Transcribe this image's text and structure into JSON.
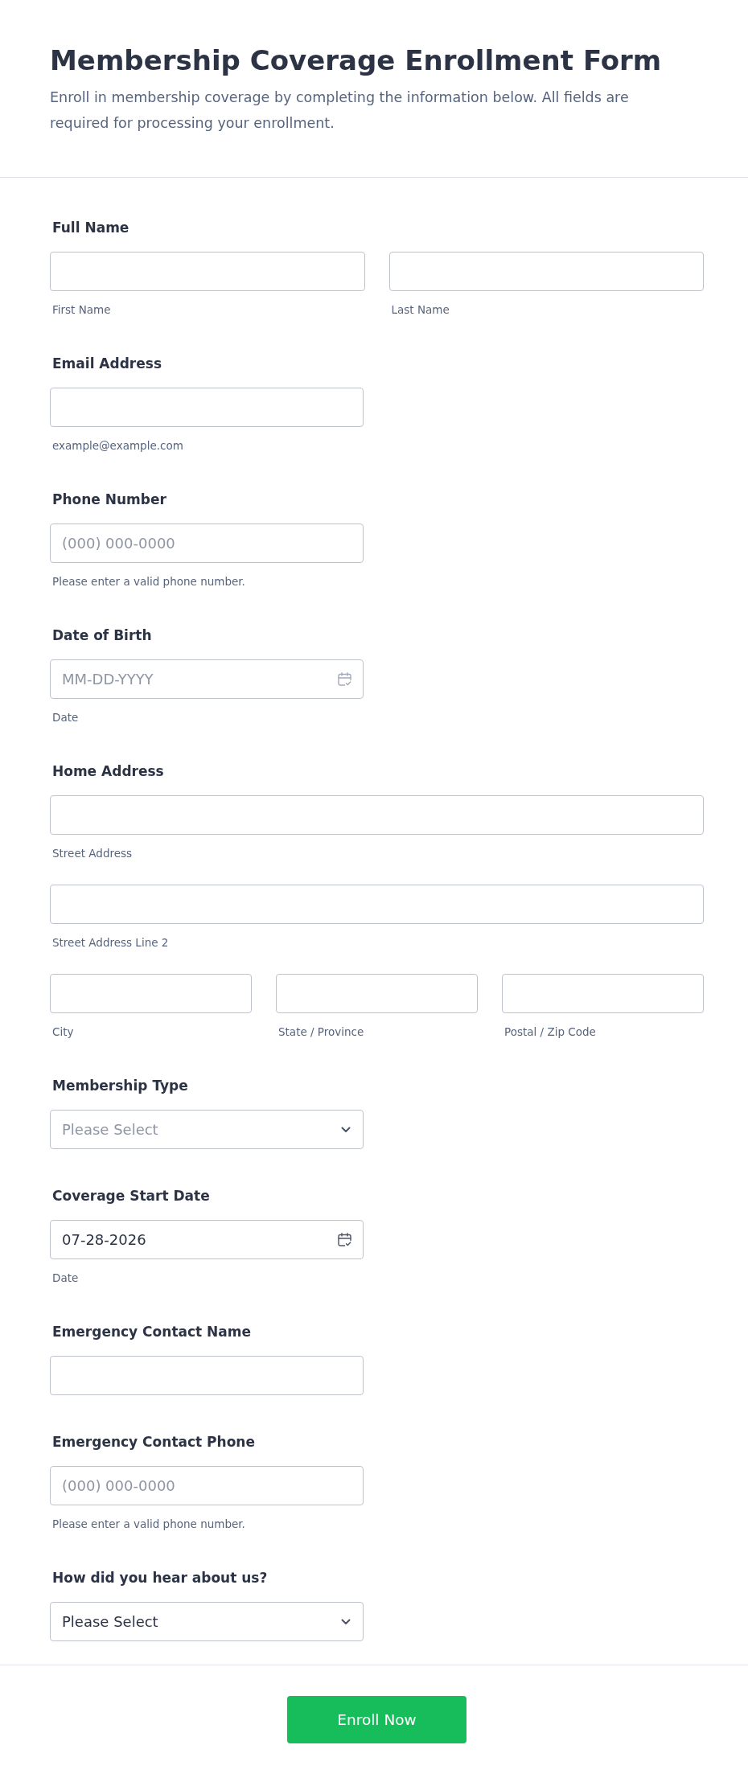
{
  "header": {
    "title": "Membership Coverage Enrollment Form",
    "description": "Enroll in membership coverage by completing the information below. All fields are required for processing your enrollment."
  },
  "fields": [
    {
      "kind": "name",
      "label": "Full Name",
      "rows": [
        [
          {
            "sublabel": "First Name"
          },
          {
            "sublabel": "Last Name"
          }
        ]
      ]
    },
    {
      "kind": "text",
      "label": "Email Address",
      "sublabel": "example@example.com"
    },
    {
      "kind": "text",
      "label": "Phone Number",
      "placeholder": "(000) 000-0000",
      "sublabel": "Please enter a valid phone number."
    },
    {
      "kind": "date",
      "label": "Date of Birth",
      "placeholder": "MM-DD-YYYY",
      "sublabel": "Date"
    },
    {
      "kind": "address",
      "label": "Home Address",
      "rows": [
        [
          {
            "sublabel": "Street Address"
          }
        ],
        [
          {
            "sublabel": "Street Address Line 2"
          }
        ],
        [
          {
            "sublabel": "City"
          },
          {
            "sublabel": "State / Province"
          },
          {
            "sublabel": "Postal / Zip Code"
          }
        ]
      ]
    },
    {
      "kind": "select",
      "label": "Membership Type",
      "placeholder": "Please Select"
    },
    {
      "kind": "date",
      "label": "Coverage Start Date",
      "value": "07-28-2026",
      "sublabel": "Date"
    },
    {
      "kind": "text",
      "label": "Emergency Contact Name"
    },
    {
      "kind": "text",
      "label": "Emergency Contact Phone",
      "placeholder": "(000) 000-0000",
      "sublabel": "Please enter a valid phone number."
    },
    {
      "kind": "select",
      "label": "How did you hear about us?",
      "value": "Please Select"
    }
  ],
  "submit_button": {
    "label": "Enroll Now"
  }
}
